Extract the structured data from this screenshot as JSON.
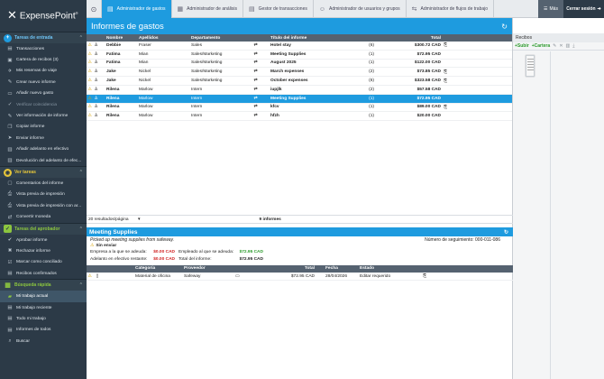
{
  "app": {
    "logo": "ExpensePoint",
    "trademark": "®"
  },
  "sidebar": {
    "sections": [
      {
        "title": "Tareas de entrada",
        "items": [
          {
            "label": "Transacciones",
            "icon": "transactions-icon",
            "glyph": "▤"
          },
          {
            "label": "Cartera de recibos (3)",
            "icon": "wallet-icon",
            "glyph": "▣"
          },
          {
            "label": "Mis reservas de viaje",
            "icon": "plane-icon",
            "glyph": "✈"
          },
          {
            "label": "Crear nuevo informe",
            "icon": "pencil-icon",
            "glyph": "✎"
          },
          {
            "label": "Añadir nuevo gasto",
            "icon": "receipt-icon",
            "glyph": "▭"
          },
          {
            "label": "Verificar coincidencia",
            "icon": "check-icon",
            "glyph": "✓"
          },
          {
            "label": "Ver información de informe",
            "icon": "edit-icon",
            "glyph": "✎"
          },
          {
            "label": "Copiar informe",
            "icon": "copy-icon",
            "glyph": "❐"
          },
          {
            "label": "Enviar informe",
            "icon": "send-icon",
            "glyph": "➤"
          },
          {
            "label": "Añadir adelanto en efectivo",
            "icon": "cash-icon",
            "glyph": "▥"
          },
          {
            "label": "Devolución del adelanto de efec...",
            "icon": "refund-icon",
            "glyph": "▥"
          }
        ]
      },
      {
        "title": "Ver tareas",
        "items": [
          {
            "label": "Comentarios del informe",
            "icon": "comment-icon",
            "glyph": "▢"
          },
          {
            "label": "Vista previa de impresión",
            "icon": "print-icon",
            "glyph": "⎙"
          },
          {
            "label": "Vista previa de impresión con ar...",
            "icon": "print-attach-icon",
            "glyph": "⎙"
          },
          {
            "label": "Convertir moneda",
            "icon": "currency-icon",
            "glyph": "⇄"
          }
        ]
      },
      {
        "title": "Tareas del aprobador",
        "items": [
          {
            "label": "Aprobar informe",
            "icon": "approve-icon",
            "glyph": "✔"
          },
          {
            "label": "Rechazar informe",
            "icon": "reject-icon",
            "glyph": "✖"
          },
          {
            "label": "Marcar como conciliado",
            "icon": "reconcile-icon",
            "glyph": "☑"
          },
          {
            "label": "Recibos confirmados",
            "icon": "receipts-confirmed-icon",
            "glyph": "▤"
          }
        ]
      },
      {
        "title": "Búsqueda rápida",
        "items": [
          {
            "label": "Mi trabajo actual",
            "icon": "folder-icon",
            "glyph": "▰"
          },
          {
            "label": "Mi trabajo reciente",
            "icon": "recent-icon",
            "glyph": "▤"
          },
          {
            "label": "Todo mi trabajo",
            "icon": "all-work-icon",
            "glyph": "▤"
          },
          {
            "label": "Informes de todos",
            "icon": "all-reports-icon",
            "glyph": "▤"
          },
          {
            "label": "Buscar",
            "icon": "search-icon",
            "glyph": "⌕"
          }
        ]
      }
    ]
  },
  "topbar": {
    "tabs": [
      {
        "label": "Administrador de gastos"
      },
      {
        "label": "Administrador de análisis"
      },
      {
        "label": "Gestor de transacciones"
      },
      {
        "label": "Administrador de usuarios y grupos"
      },
      {
        "label": "Administrador de flujos de trabajo"
      }
    ],
    "more": "Más",
    "logout": "Cerrar sesión"
  },
  "main": {
    "title": "Informes de gastos",
    "columns": {
      "name": "Nombre",
      "last": "Apellidos",
      "dept": "Departamento",
      "title": "Título del informe",
      "total": "Total"
    },
    "rows": [
      {
        "name": "Debbie",
        "last": "Fraser",
        "dept": "Sales",
        "title": "Hotel stay",
        "count": "(6)",
        "total": "$300.72 CAD",
        "clip": true,
        "sel": false
      },
      {
        "name": "Fatima",
        "last": "Mian",
        "dept": "Sales/Marketing",
        "title": "Meeting Supplies",
        "count": "(1)",
        "total": "$72.95 CAD",
        "clip": false,
        "sel": false
      },
      {
        "name": "Fatima",
        "last": "Mian",
        "dept": "Sales/Marketing",
        "title": "August 2025",
        "count": "(1)",
        "total": "$122.00 CAD",
        "clip": false,
        "sel": false
      },
      {
        "name": "Jake",
        "last": "Nickel",
        "dept": "Sales/Marketing",
        "title": "March expenses",
        "count": "(2)",
        "total": "$73.85 CAD",
        "clip": true,
        "sel": false
      },
      {
        "name": "Jake",
        "last": "Nickel",
        "dept": "Sales/Marketing",
        "title": "October expenses",
        "count": "(6)",
        "total": "$323.58 CAD",
        "clip": true,
        "sel": false
      },
      {
        "name": "Rilena",
        "last": "Marlow",
        "dept": "Intern",
        "title": "iupjlk",
        "count": "(2)",
        "total": "$57.58 CAD",
        "clip": false,
        "sel": false
      },
      {
        "name": "Rilena",
        "last": "Marlow",
        "dept": "Intern",
        "title": "Meeting Supplies",
        "count": "(1)",
        "total": "$72.95 CAD",
        "clip": false,
        "sel": true
      },
      {
        "name": "Rilena",
        "last": "Marlow",
        "dept": "Intern",
        "title": "kfcv",
        "count": "(1)",
        "total": "$89.00 CAD",
        "clip": true,
        "sel": false
      },
      {
        "name": "Rilena",
        "last": "Marlow",
        "dept": "Intern",
        "title": "hfzh",
        "count": "(1)",
        "total": "$20.00 CAD",
        "clip": false,
        "sel": false
      }
    ],
    "pager": {
      "per_page": "20 resultados/página",
      "count": "9 informes"
    }
  },
  "detail": {
    "title": "Meeting Supplies",
    "memo": "Picked up meeting supplies from safeway.",
    "tracking": "Número de seguimiento: 000-011-086",
    "status": "Sin enviar",
    "owed_company_label": "Empresa a la que se adeuda:",
    "owed_company_value": "$0.00 CAD",
    "owed_employee_label": "Empleado al que se adeuda:",
    "owed_employee_value": "$72.95 CAD",
    "advance_label": "Adelanto en efectivo restante:",
    "advance_value": "$0.00 CAD",
    "report_total_label": "Total del informe:",
    "report_total_value": "$72.95 CAD",
    "columns": {
      "cat": "Categoría",
      "prov": "Proveedor",
      "total": "Total",
      "date": "Fecha",
      "status": "Estado"
    },
    "expenses": [
      {
        "cat": "Material de oficina",
        "prov": "Safeway",
        "total": "$72.95 CAD",
        "date": "28/04/2026",
        "status": "Editar requerido"
      }
    ]
  },
  "receipts": {
    "title": "Recibos",
    "upload": "Subir",
    "wallet": "Cartera"
  },
  "colors": {
    "accent": "#1e9bdf",
    "sidebar": "#2c3a47",
    "header": "#556270",
    "warning": "#d9a300",
    "approve": "#8cc63f"
  }
}
